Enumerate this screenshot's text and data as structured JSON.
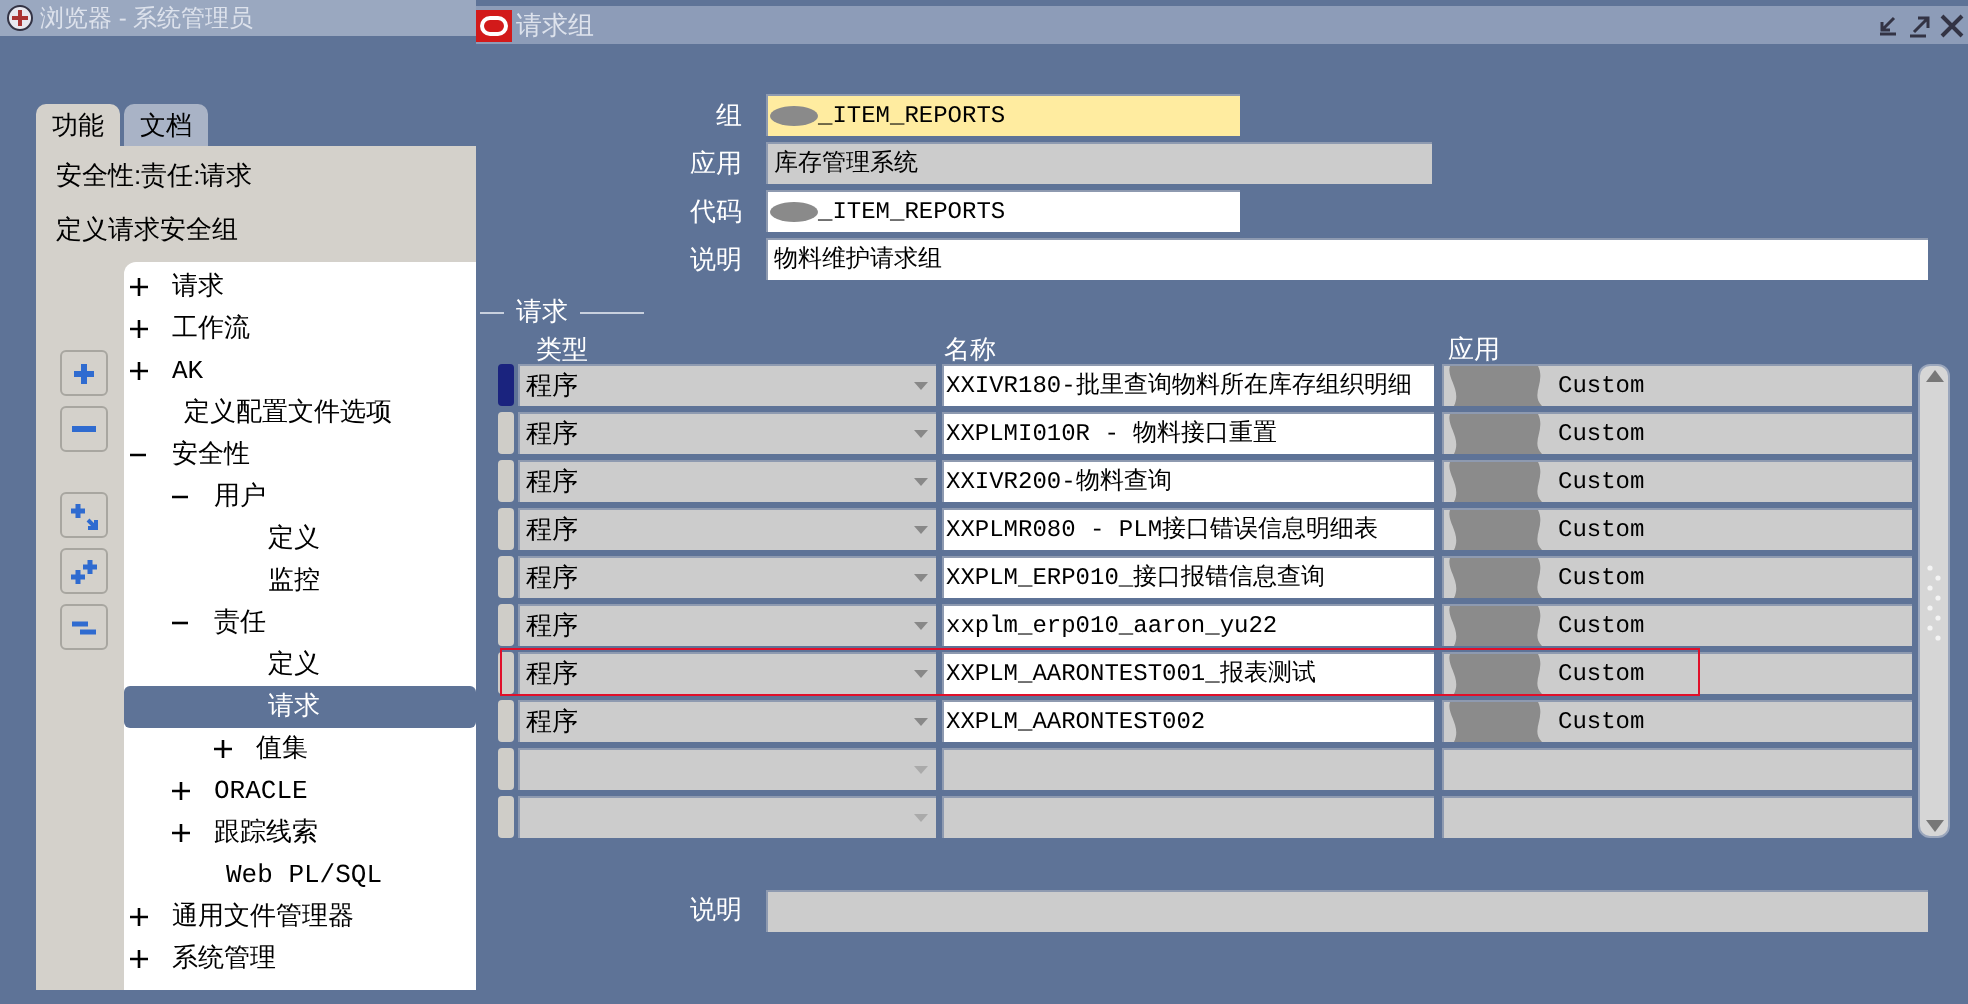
{
  "left_window": {
    "title": "浏览器 - 系统管理员",
    "tabs": [
      {
        "label": "功能",
        "selected": true
      },
      {
        "label": "文档",
        "selected": false
      }
    ],
    "path": "安全性:责任:请求",
    "heading": "定义请求安全组",
    "tree": [
      {
        "label": "请求",
        "expanded": false,
        "selected": false
      },
      {
        "label": "工作流",
        "expanded": false,
        "selected": false
      },
      {
        "label": "AK",
        "expanded": false,
        "selected": false
      },
      {
        "label": "定义配置文件选项",
        "selected": false
      },
      {
        "label": "安全性",
        "expanded": true,
        "selected": false,
        "children": [
          {
            "label": "用户",
            "expanded": true,
            "selected": false,
            "children": [
              {
                "label": "定义",
                "selected": false
              },
              {
                "label": "监控",
                "selected": false
              }
            ]
          },
          {
            "label": "责任",
            "expanded": true,
            "selected": false,
            "children": [
              {
                "label": "定义",
                "selected": false
              },
              {
                "label": "请求",
                "selected": true
              },
              {
                "label": "值集",
                "expanded": false,
                "selected": false
              }
            ]
          },
          {
            "label": "ORACLE",
            "expanded": false,
            "selected": false
          },
          {
            "label": "跟踪线索",
            "expanded": false,
            "selected": false
          },
          {
            "label": "Web PL/SQL",
            "selected": false
          }
        ]
      },
      {
        "label": "通用文件管理器",
        "expanded": false,
        "selected": false
      },
      {
        "label": "系统管理",
        "expanded": false,
        "selected": false
      }
    ]
  },
  "form": {
    "title": "请求组",
    "fields": [
      {
        "label": "组",
        "value": "_ITEM_REPORTS",
        "kind": "required"
      },
      {
        "label": "应用",
        "value": "库存管理系统",
        "kind": "readonly"
      },
      {
        "label": "代码",
        "value": "_ITEM_REPORTS",
        "kind": "text"
      },
      {
        "label": "说明",
        "value": "物料维护请求组",
        "kind": "description"
      }
    ],
    "section": "请求",
    "columns": [
      "类型",
      "名称",
      "应用"
    ],
    "rows": [
      {
        "type": "程序",
        "name": "XXIVR180-批里查询物料所在库存组织明细",
        "application": "Custom",
        "current": true,
        "annotated": false
      },
      {
        "type": "程序",
        "name": "XXPLMI010R - 物料接口重置",
        "application": "Custom",
        "current": false,
        "annotated": false
      },
      {
        "type": "程序",
        "name": "XXIVR200-物料查询",
        "application": "Custom",
        "current": false,
        "annotated": false
      },
      {
        "type": "程序",
        "name": "XXPLMR080 - PLM接口错误信息明细表",
        "application": "Custom",
        "current": false,
        "annotated": false
      },
      {
        "type": "程序",
        "name": "XXPLM_ERP010_接口报错信息查询",
        "application": "Custom",
        "current": false,
        "annotated": false
      },
      {
        "type": "程序",
        "name": "xxplm_erp010_aaron_yu22",
        "application": "Custom",
        "current": false,
        "annotated": false
      },
      {
        "type": "程序",
        "name": "XXPLM_AARONTEST001_报表测试",
        "application": "Custom",
        "current": false,
        "annotated": true
      },
      {
        "type": "程序",
        "name": "XXPLM_AARONTEST002",
        "application": "Custom",
        "current": false,
        "annotated": false
      },
      {
        "current": false,
        "annotated": false
      },
      {
        "current": false,
        "annotated": false
      }
    ],
    "bottom_label": "说明"
  }
}
